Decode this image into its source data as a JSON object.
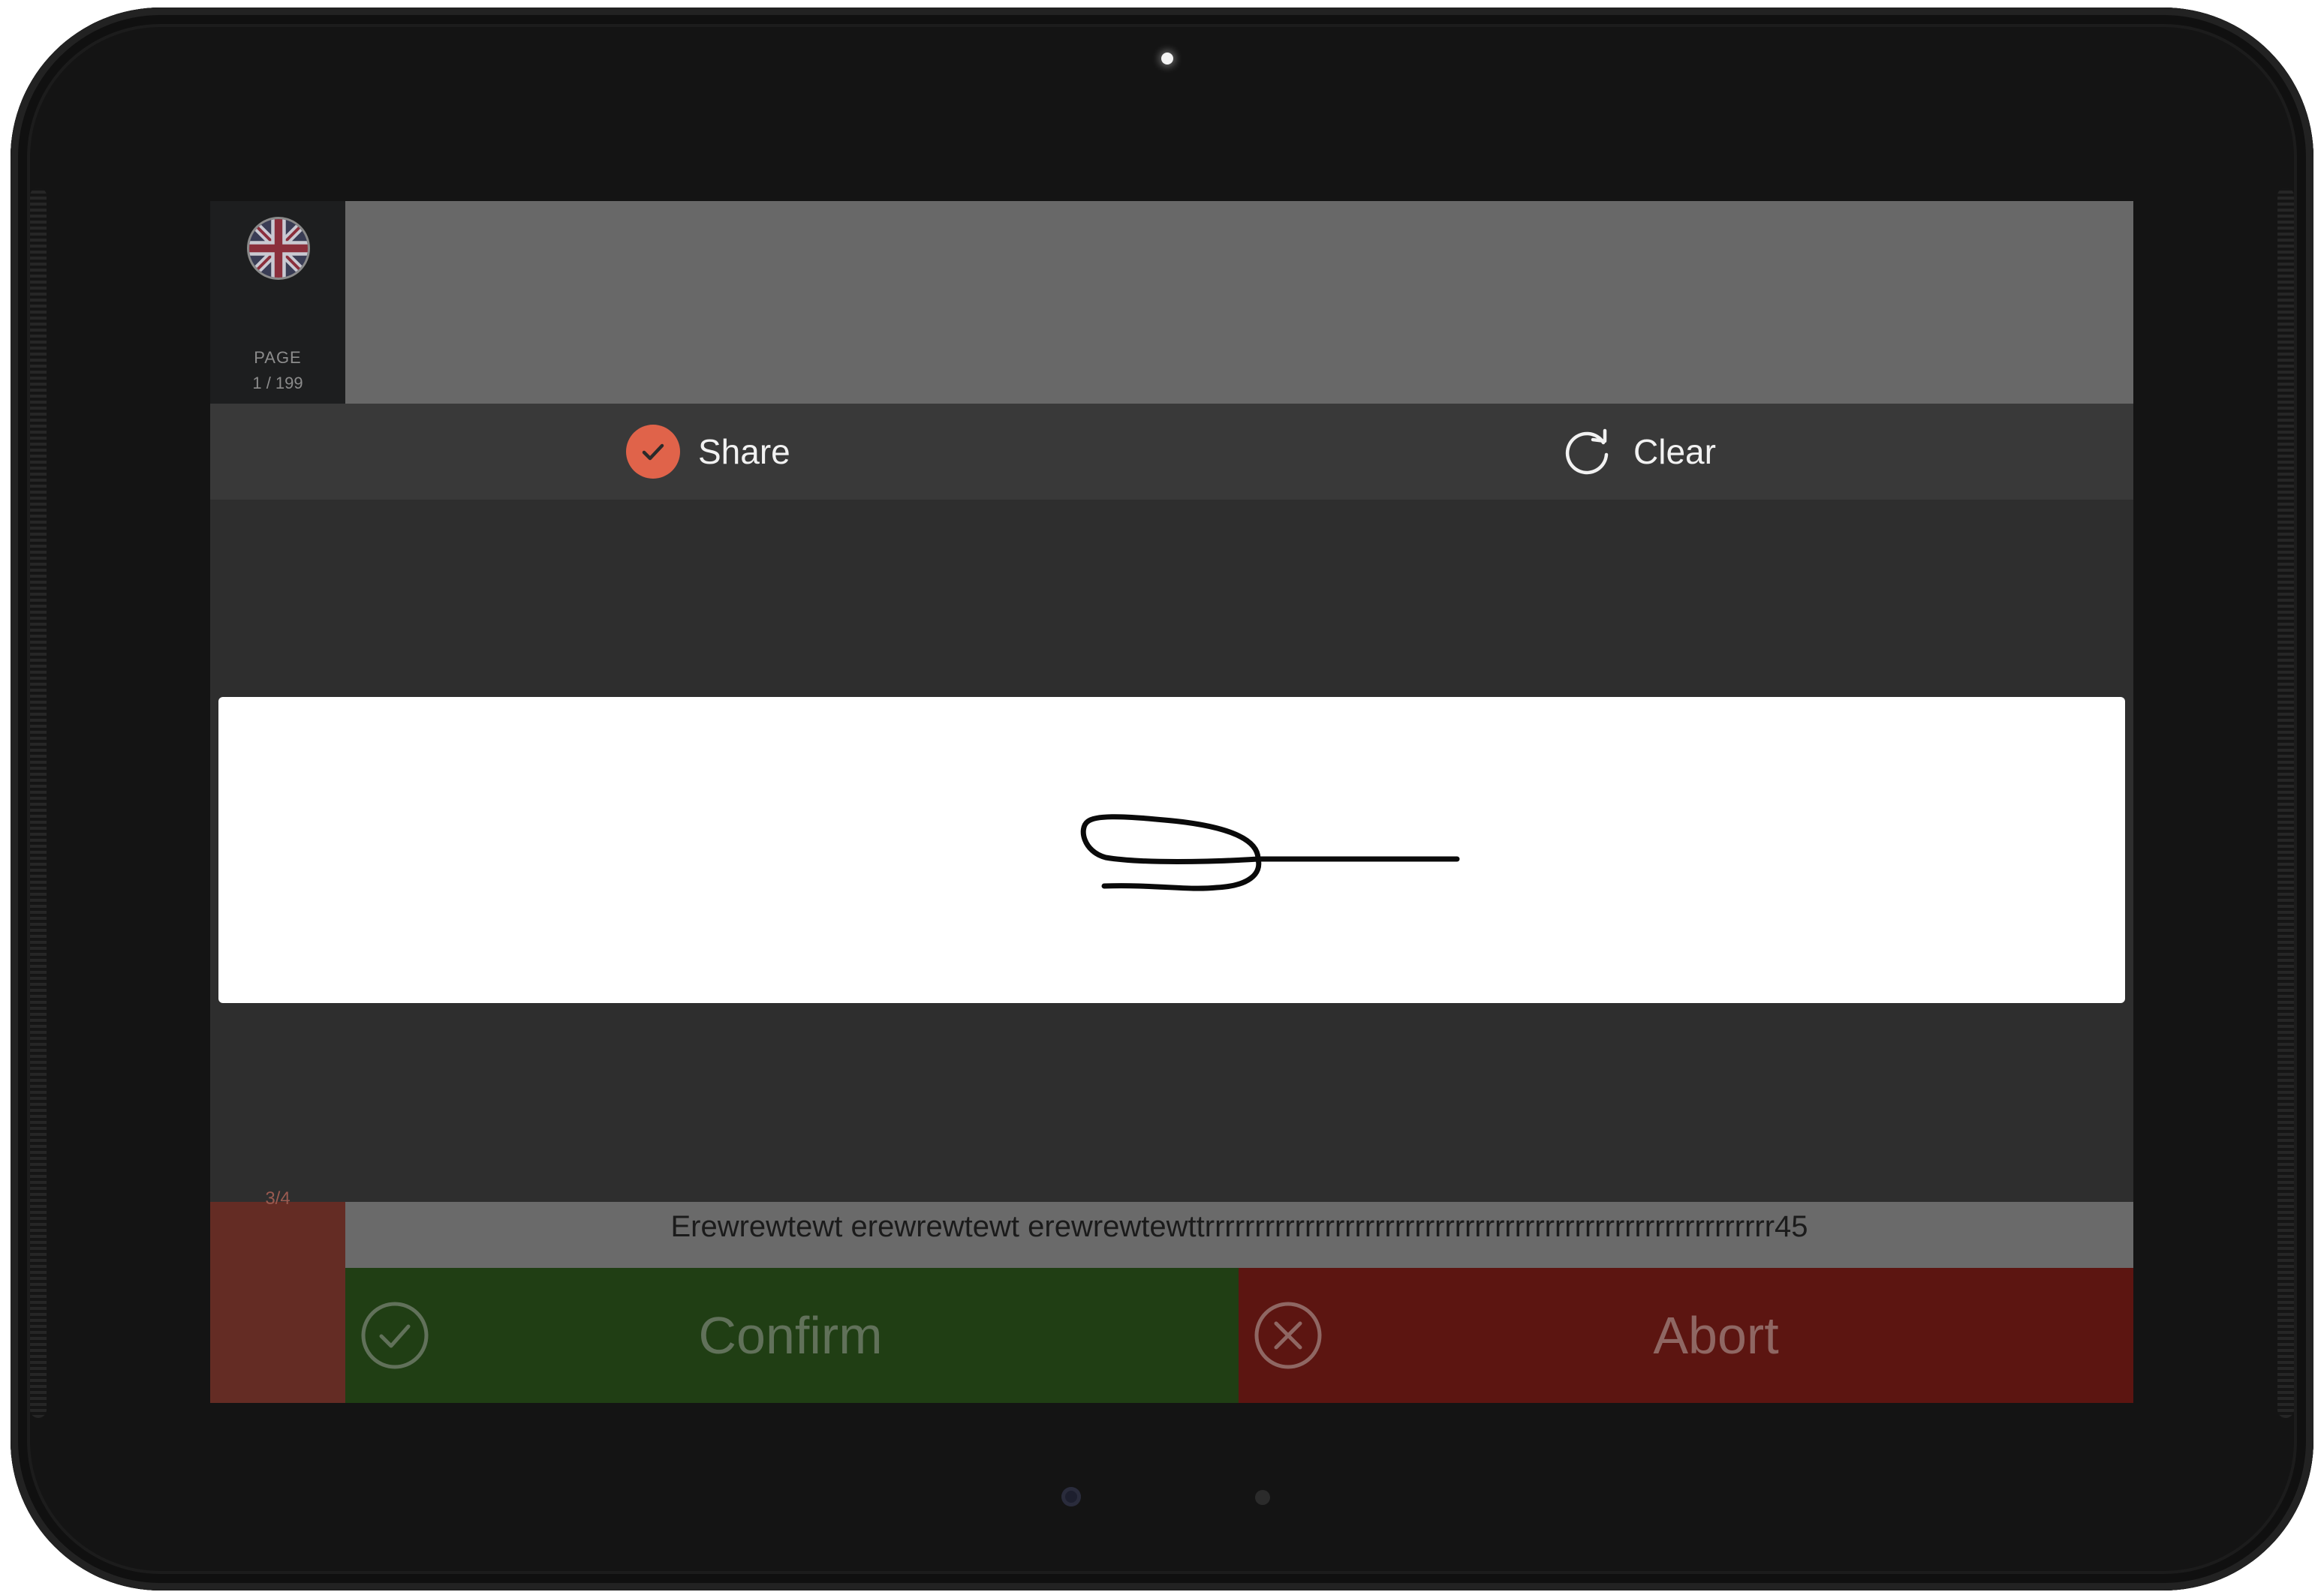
{
  "header": {
    "language_icon": "uk-flag-icon",
    "page_label": "PAGE",
    "page_count": "1 / 199"
  },
  "toolbar": {
    "share_label": "Share",
    "share_icon": "check-circle-icon",
    "clear_label": "Clear",
    "clear_icon": "refresh-icon"
  },
  "signature": {
    "description_icon": "signature-stroke"
  },
  "footer": {
    "side_text": "3/4",
    "info_text": "Erewrewtewt erewrewtewt erewrewtewttrrrrrrrrrrrrrrrrrrrrrrrrrrrrrrrrrrrrrrrrrrrrrrrrrrrrrrrrr45",
    "confirm_label": "Confirm",
    "confirm_icon": "check-circle-outline-icon",
    "abort_label": "Abort",
    "abort_icon": "x-circle-outline-icon"
  },
  "colors": {
    "accent_share": "#e0634a",
    "confirm_bg": "#203e14",
    "abort_bg": "#5c1511",
    "header_bg": "#686868",
    "toolbar_bg": "#393939",
    "overlay_bg": "#2e2e2e"
  }
}
